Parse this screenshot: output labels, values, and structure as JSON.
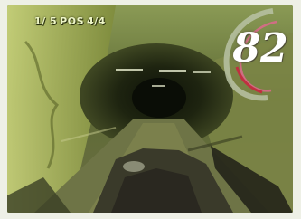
{
  "hud": {
    "lap_label": "1/ 5",
    "position_label": "POS",
    "position_value": "4/4",
    "speed": "82",
    "dial_colors": {
      "outer": "#b9c2a4",
      "inner": "#d86a8a",
      "accent": "#c03040"
    }
  },
  "scene": {
    "colors": {
      "sky": "#9aa86a",
      "tunnel": "#1e2410",
      "ground": "#7a7e4c",
      "foliage": "#b9c265",
      "car": "#2a2820"
    }
  }
}
